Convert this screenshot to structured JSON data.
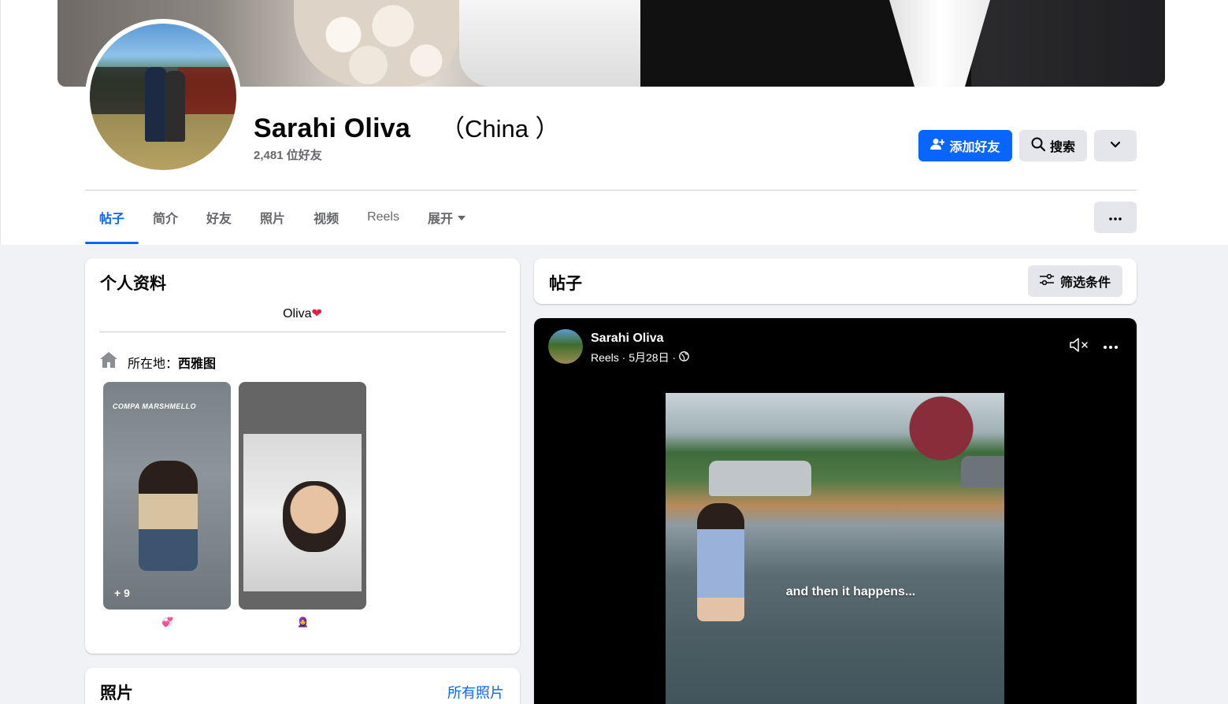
{
  "profile": {
    "name": "Sarahi Oliva",
    "region": "（China ）",
    "friends_count": "2,481 位好友"
  },
  "actions": {
    "add_friend": "添加好友",
    "search": "搜索"
  },
  "tabs": [
    {
      "label": "帖子",
      "active": true
    },
    {
      "label": "简介"
    },
    {
      "label": "好友"
    },
    {
      "label": "照片"
    },
    {
      "label": "视频"
    },
    {
      "label": "Reels"
    },
    {
      "label": "展开"
    }
  ],
  "intro": {
    "title": "个人资料",
    "bio": "Oliva",
    "bio_emoji": "❤",
    "location_prefix": "所在地：",
    "location_city": "西雅图",
    "highlights": [
      {
        "overlay_text": "COMPA MARSHMELLO",
        "count": "+ 9",
        "emoji": "💞"
      },
      {
        "emoji": "🧕"
      }
    ]
  },
  "photos_card": {
    "title": "照片",
    "all_photos": "所有照片"
  },
  "posts_header": {
    "title": "帖子",
    "filter": "筛选条件"
  },
  "post": {
    "author": "Sarahi Oliva",
    "meta": "Reels · 5月28日 ·",
    "video_caption": "and then it happens..."
  },
  "colors": {
    "accent": "#0866ff",
    "secondary_button": "#e4e6eb",
    "page_background": "#f0f2f5"
  }
}
